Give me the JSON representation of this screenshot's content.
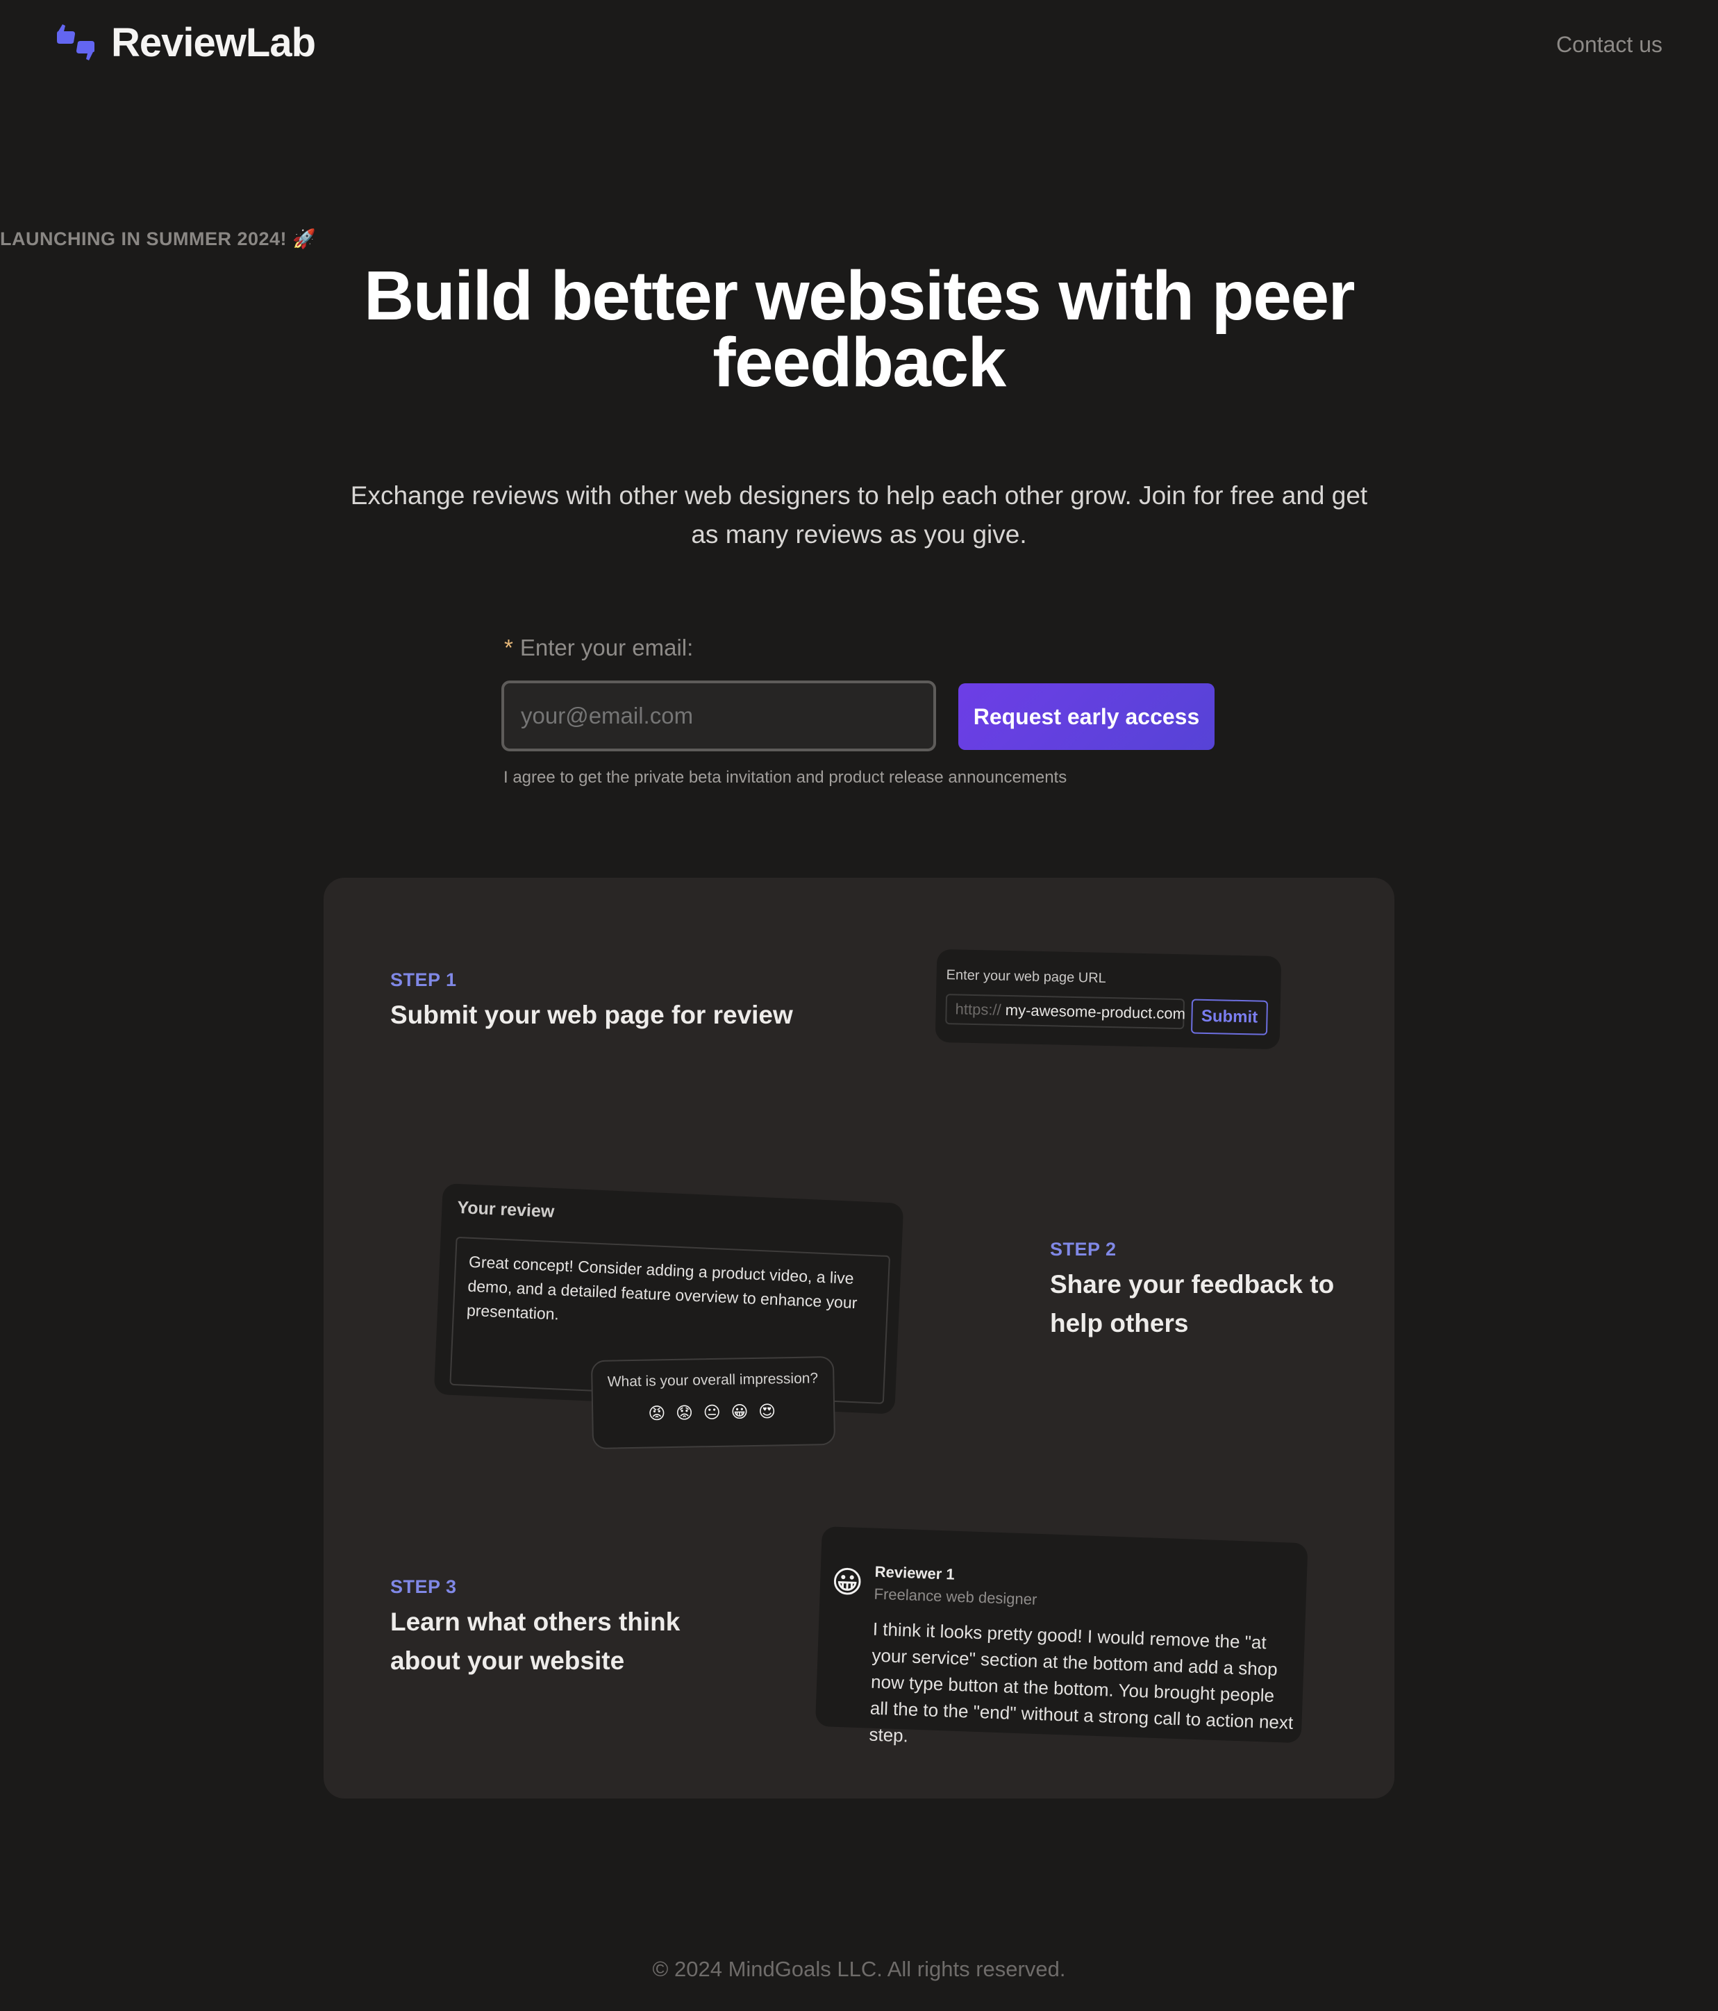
{
  "header": {
    "brand": "ReviewLab",
    "logo_icon": "thumbs-up-down-icon",
    "contact_label": "Contact us",
    "brand_color": "#6366f1"
  },
  "hero": {
    "eyebrow": "LAUNCHING IN SUMMER 2024! 🚀",
    "title": "Build better websites with peer feedback",
    "subtitle": "Exchange reviews with other web designers to help each other grow. Join for free and get as many reviews as you give."
  },
  "signup": {
    "required_marker": "*",
    "label": "Enter your email:",
    "email_placeholder": "your@email.com",
    "email_value": "",
    "cta_label": "Request early access",
    "consent": "I agree to get the private beta invitation and product release announcements"
  },
  "steps": [
    {
      "number": "STEP 1",
      "title": "Submit your web page for review",
      "demo": {
        "label": "Enter your web page URL",
        "prefix": "https://",
        "value": "my-awesome-product.com",
        "button": "Submit"
      }
    },
    {
      "number": "STEP 2",
      "title": "Share your feedback to help others",
      "demo": {
        "label": "Your review",
        "text": "Great concept! Consider adding a product video, a live demo, and a detailed feature overview to enhance your presentation.",
        "impression_label": "What is your overall impression?",
        "emojis": [
          "😡",
          "😟",
          "😐",
          "😀",
          "😍"
        ]
      }
    },
    {
      "number": "STEP 3",
      "title": "Learn what others think about your website",
      "demo": {
        "avatar": "😀",
        "reviewer": "Reviewer 1",
        "role": "Freelance web designer",
        "text": "I think it looks pretty good! I would remove the \"at your service\" section at the bottom and add a shop now type button at the bottom. You brought people all the to the \"end\" without a strong call to action next step."
      }
    }
  ],
  "footer": {
    "copyright": "© 2024 MindGoals LLC. All rights reserved."
  }
}
